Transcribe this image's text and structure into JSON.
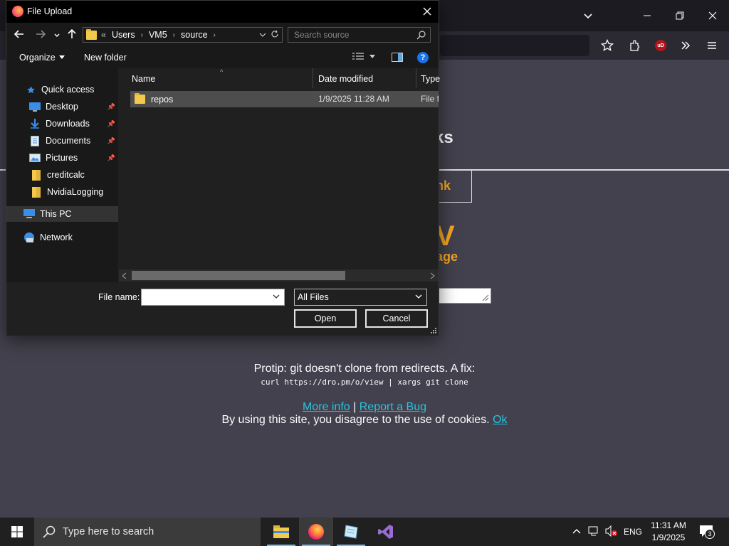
{
  "browser": {
    "toolbar_icons": [
      "chevron-down-icon",
      "minimize-icon",
      "restore-icon",
      "close-icon",
      "star-icon",
      "extensions-icon",
      "ublock-icon",
      "overflow-icon",
      "menu-icon"
    ],
    "ublock_badge": "uD"
  },
  "webpage": {
    "partial_heading": "ks",
    "partial_link_box": "nk",
    "big_letter": "V",
    "partial_subtitle": "age",
    "protip_text": "Protip: git doesn't clone from redirects. A fix:",
    "protip_code": "curl https://dro.pm/o/view | xargs git clone",
    "more_info": "More info",
    "separator": "|",
    "report_bug": "Report a Bug",
    "cookie_text": "By using this site, you disagree to the use of cookies.",
    "cookie_ok": "Ok",
    "colors": {
      "accent_orange": "#f5a623",
      "link_cyan": "#2ac3de"
    }
  },
  "dialog": {
    "title": "File Upload",
    "breadcrumb": [
      "«",
      "Users",
      "VM5",
      "source"
    ],
    "search_placeholder": "Search source",
    "organize_label": "Organize",
    "new_folder_label": "New folder",
    "nav": {
      "quick_access": "Quick access",
      "items": [
        {
          "label": "Desktop",
          "pinned": true
        },
        {
          "label": "Downloads",
          "pinned": true
        },
        {
          "label": "Documents",
          "pinned": true
        },
        {
          "label": "Pictures",
          "pinned": true
        },
        {
          "label": "creditcalc",
          "pinned": false
        },
        {
          "label": "NvidiaLogging",
          "pinned": false
        }
      ],
      "this_pc": "This PC",
      "network": "Network"
    },
    "columns": {
      "name": "Name",
      "date": "Date modified",
      "type": "Type"
    },
    "files": [
      {
        "name": "repos",
        "date": "1/9/2025 11:28 AM",
        "type": "File fo"
      }
    ],
    "filename_label": "File name:",
    "filename_value": "",
    "filetype_value": "All Files",
    "open_label": "Open",
    "cancel_label": "Cancel"
  },
  "taskbar": {
    "search_placeholder": "Type here to search",
    "apps": [
      "file-explorer-icon",
      "firefox-icon",
      "notepad-icon",
      "visual-studio-icon"
    ],
    "language": "ENG",
    "time": "11:31 AM",
    "date": "1/9/2025",
    "notification_count": "3"
  }
}
